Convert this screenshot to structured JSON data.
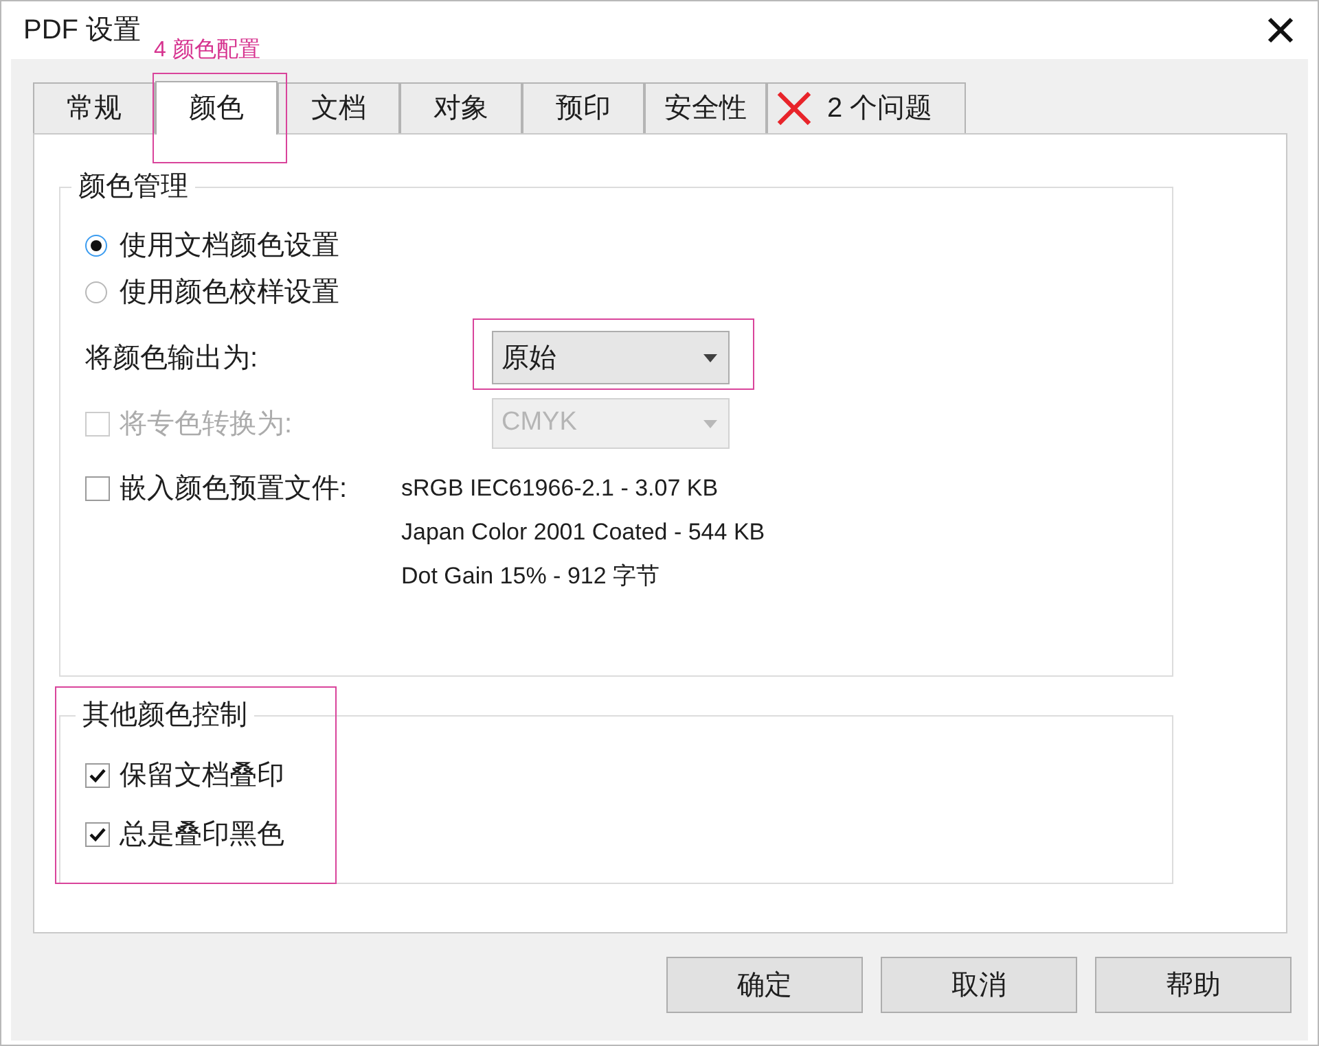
{
  "window": {
    "title": "PDF 设置"
  },
  "tabs": [
    {
      "label": "常规",
      "kind": "text",
      "selected": false,
      "highlighted": false
    },
    {
      "label": "颜色",
      "kind": "text",
      "selected": true,
      "highlighted": true,
      "callout": "4 颜色配置"
    },
    {
      "label": "文档",
      "kind": "text",
      "selected": false,
      "highlighted": false
    },
    {
      "label": "对象",
      "kind": "text",
      "selected": false,
      "highlighted": false
    },
    {
      "label": "预印",
      "kind": "text",
      "selected": false,
      "highlighted": false
    },
    {
      "label": "安全性",
      "kind": "text",
      "selected": false,
      "highlighted": false
    },
    {
      "label": "2 个问题",
      "kind": "issues",
      "selected": false,
      "highlighted": false
    }
  ],
  "color_management": {
    "title": "颜色管理",
    "options": [
      {
        "label": "使用文档颜色设置",
        "selected": true
      },
      {
        "label": "使用颜色校样设置",
        "selected": false
      }
    ],
    "output": {
      "label": "将颜色输出为:",
      "value": "原始",
      "highlighted": true
    },
    "spot_convert": {
      "label": "将专色转换为:",
      "checked": false,
      "disabled": true,
      "value": "CMYK"
    },
    "embed_profile": {
      "label": "嵌入颜色预置文件:",
      "checked": false,
      "profiles": [
        "sRGB IEC61966-2.1 - 3.07 KB",
        "Japan Color 2001 Coated - 544 KB",
        "Dot Gain 15% - 912 字节"
      ]
    }
  },
  "other_color_controls": {
    "title": "其他颜色控制",
    "highlighted": true,
    "options": [
      {
        "label": "保留文档叠印",
        "checked": true
      },
      {
        "label": "总是叠印黑色",
        "checked": true
      }
    ]
  },
  "buttons": [
    "确定",
    "取消",
    "帮助"
  ]
}
